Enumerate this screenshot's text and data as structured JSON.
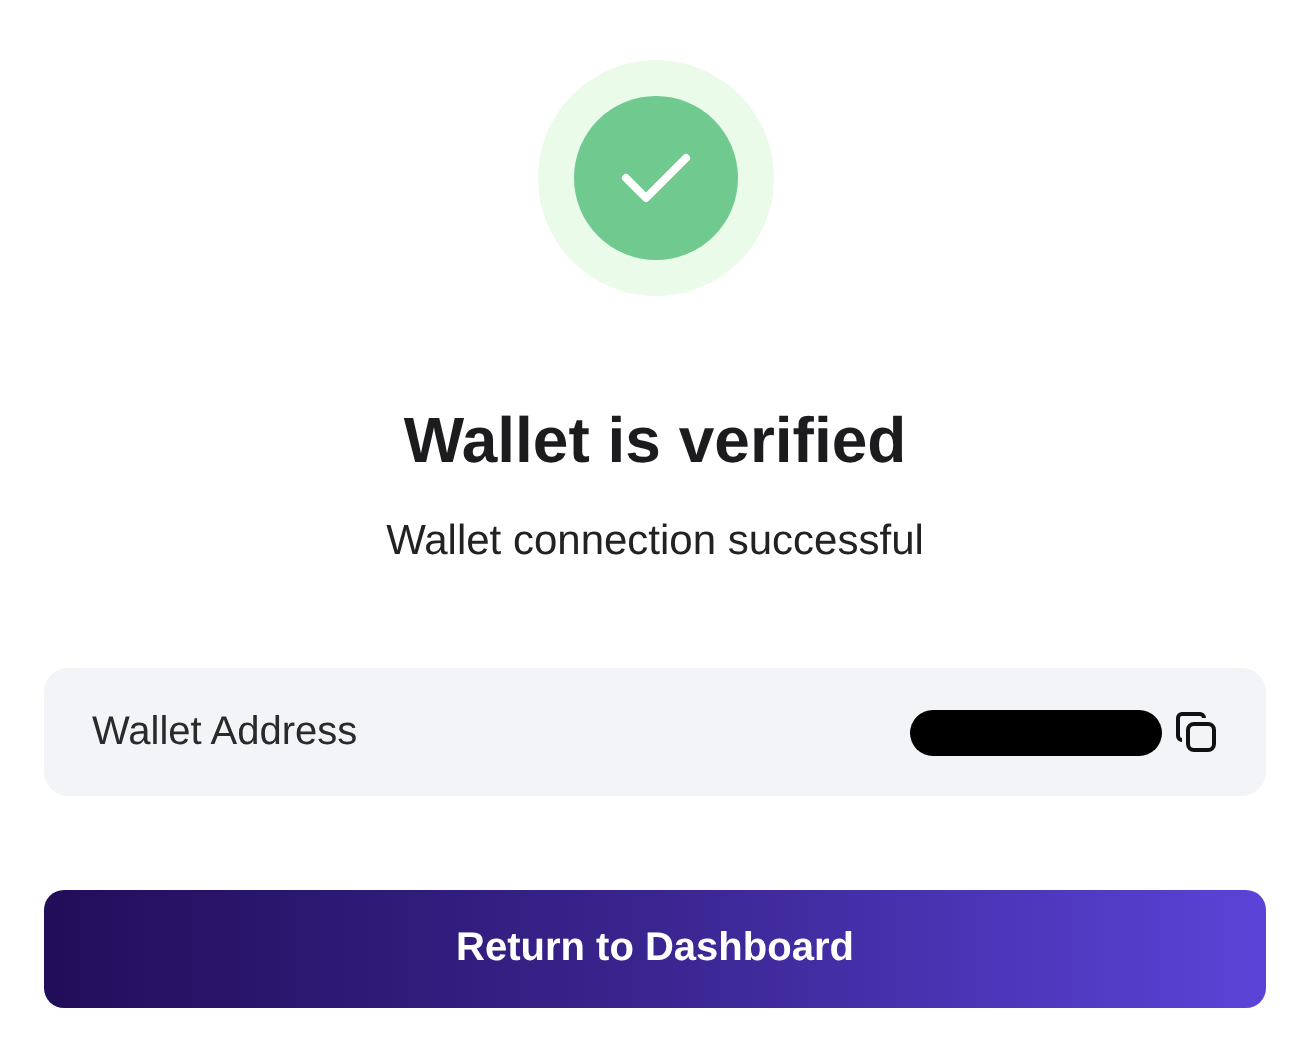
{
  "status": {
    "title": "Wallet is verified",
    "subtitle": "Wallet connection successful"
  },
  "address": {
    "label": "Wallet Address",
    "redacted": true
  },
  "button": {
    "label": "Return to Dashboard"
  }
}
